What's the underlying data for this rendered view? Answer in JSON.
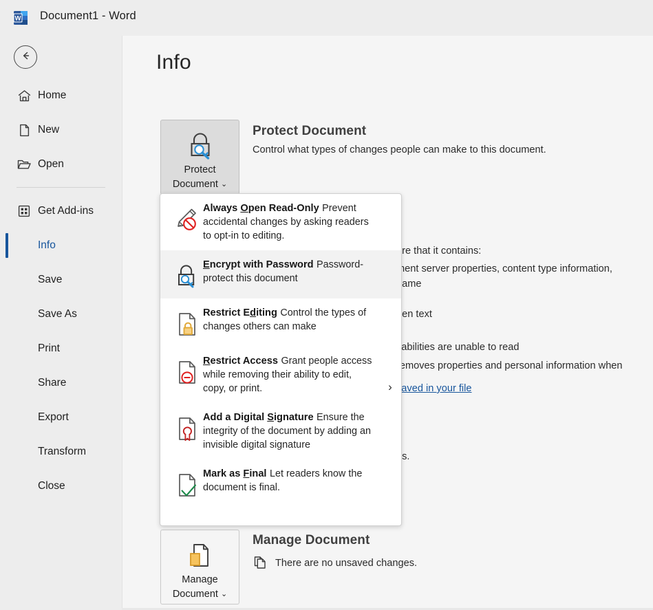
{
  "titlebar": {
    "app_icon": "word-logo-icon",
    "title": "Document1  -  Word"
  },
  "backstage": {
    "back_button": "back-arrow-icon",
    "items": [
      {
        "label": "Home",
        "icon": "home-icon",
        "active": false
      },
      {
        "label": "New",
        "icon": "new-document-icon",
        "active": false
      },
      {
        "label": "Open",
        "icon": "open-folder-icon",
        "active": false
      },
      {
        "separator": true
      },
      {
        "label": "Get Add-ins",
        "icon": "add-ins-grid-icon",
        "active": false
      },
      {
        "label": "Info",
        "icon": null,
        "active": true
      },
      {
        "label": "Save",
        "icon": null,
        "active": false
      },
      {
        "label": "Save As",
        "icon": null,
        "active": false
      },
      {
        "label": "Print",
        "icon": null,
        "active": false
      },
      {
        "label": "Share",
        "icon": null,
        "active": false
      },
      {
        "label": "Export",
        "icon": null,
        "active": false
      },
      {
        "label": "Transform",
        "icon": null,
        "active": false
      },
      {
        "label": "Close",
        "icon": null,
        "active": false
      }
    ]
  },
  "main": {
    "page_title": "Info",
    "protect": {
      "tile_line1": "Protect",
      "tile_line2": "Document",
      "tile_chevron": "⌄",
      "heading": "Protect Document",
      "description": "Control what types of changes people can make to this document."
    },
    "inspect_obscured": {
      "line1": "are that it contains:",
      "line2": "ment server properties, content type information,",
      "line3": " name",
      "line4": "den text",
      "line5": "sabilities are unable to read",
      "line6": "removes properties and personal information when",
      "link": " saved in your file",
      "line7": "ns."
    },
    "manage": {
      "tile_line1": "Manage",
      "tile_line2": "Document",
      "tile_chevron": "⌄",
      "heading": "Manage Document",
      "status_icon": "unsaved-changes-icon",
      "status": "There are no unsaved changes."
    }
  },
  "dropdown": {
    "items": [
      {
        "icon": "always-open-read-only-icon",
        "title_pre": "Always ",
        "title_key": "O",
        "title_post": "pen Read-Only",
        "desc": "Prevent accidental changes by asking readers to opt-in to editing.",
        "highlighted": false,
        "has_submenu": false
      },
      {
        "icon": "encrypt-with-password-icon",
        "title_pre": "",
        "title_key": "E",
        "title_post": "ncrypt with Password",
        "desc": "Password-protect this document",
        "highlighted": true,
        "has_submenu": false
      },
      {
        "icon": "restrict-editing-icon",
        "title_pre": "Restrict E",
        "title_key": "d",
        "title_post": "iting",
        "desc": "Control the types of changes others can make",
        "highlighted": false,
        "has_submenu": false
      },
      {
        "icon": "restrict-access-icon",
        "title_pre": "",
        "title_key": "R",
        "title_post": "estrict Access",
        "desc": "Grant people access while removing their ability to edit, copy, or print.",
        "highlighted": false,
        "has_submenu": true
      },
      {
        "icon": "add-digital-signature-icon",
        "title_pre": "Add a Digital ",
        "title_key": "S",
        "title_post": "ignature",
        "desc": "Ensure the integrity of the document by adding an invisible digital signature",
        "highlighted": false,
        "has_submenu": false
      },
      {
        "icon": "mark-as-final-icon",
        "title_pre": "Mark as ",
        "title_key": "F",
        "title_post": "inal",
        "desc": "Let readers know the document is final.",
        "highlighted": false,
        "has_submenu": false
      }
    ],
    "submenu_chevron": "›"
  },
  "colors": {
    "accent_blue": "#17559c",
    "window_bg": "#ededed",
    "panel_bg": "#f5f5f5",
    "menu_bg": "#ffffff",
    "highlight_bg": "#f2f2f2"
  }
}
